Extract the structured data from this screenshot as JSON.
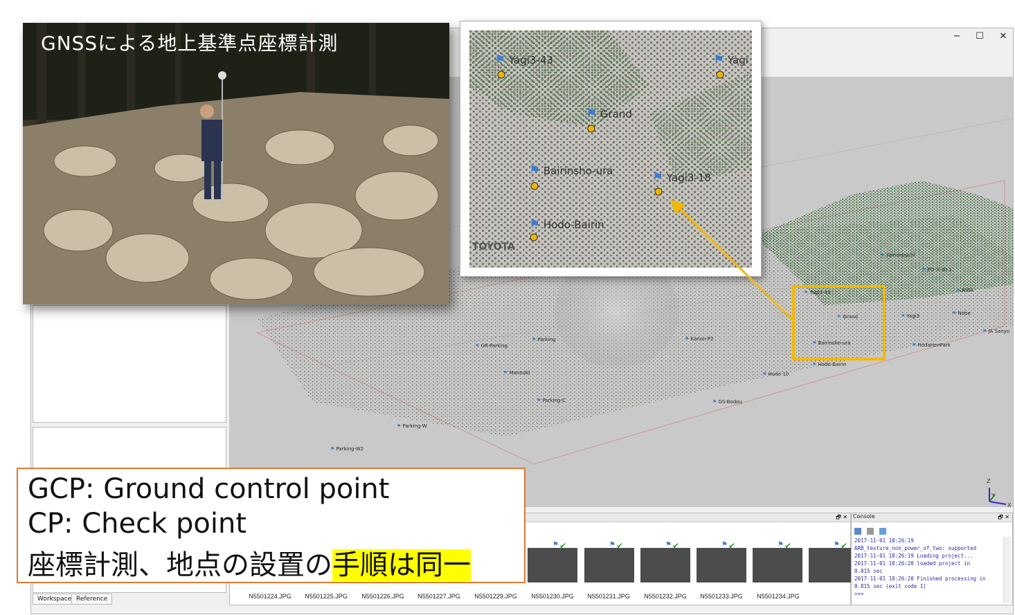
{
  "photo": {
    "title": "GNSSによる地上基準点座標計測"
  },
  "window_controls": {
    "minimize": "−",
    "maximize": "☐",
    "close": "✕"
  },
  "info_box": {
    "line1": "GCP: Ground control point",
    "line2": "CP: Check point",
    "line3_prefix": "座標計測、地点の設置の",
    "line3_highlight": "手順は同一"
  },
  "left_panel": {
    "tabs": [
      "Workspace",
      "Reference"
    ]
  },
  "zoom_markers": [
    {
      "label": "Yagi3-43"
    },
    {
      "label": "Yagi"
    },
    {
      "label": "Grand"
    },
    {
      "label": "Bairinsho-ura"
    },
    {
      "label": "Yagi3-18"
    },
    {
      "label": "Hodo-Bairin"
    }
  ],
  "zoom_text": "TOYOTA",
  "scene_markers": [
    {
      "label": "GR-Parking"
    },
    {
      "label": "Parking"
    },
    {
      "label": "Kanon-P2"
    },
    {
      "label": "Mannobi"
    },
    {
      "label": "Parking-C"
    },
    {
      "label": "Parking-W"
    },
    {
      "label": "Parking-W2"
    },
    {
      "label": "GS-Bodou"
    },
    {
      "label": "Hodo-10"
    },
    {
      "label": "Bairinsho-ura"
    },
    {
      "label": "Hodo-Bairin"
    },
    {
      "label": "Grand"
    },
    {
      "label": "Yagi3-43"
    },
    {
      "label": "PO-3-30-1"
    },
    {
      "label": "NWA"
    },
    {
      "label": "Yagi3"
    },
    {
      "label": "Nobe"
    },
    {
      "label": "HodaHenPark"
    },
    {
      "label": "JA Sanyo"
    },
    {
      "label": "Yamanouchi"
    }
  ],
  "axes": {
    "z": "Z",
    "y": "Y",
    "x": "X"
  },
  "photos": [
    "N5501224.JPG",
    "N5501225.JPG",
    "N5501226.JPG",
    "N5501227.JPG",
    "N5501229.JPG",
    "N5501230.JPG",
    "N5501231.JPG",
    "N5501232.JPG",
    "N5501233.JPG",
    "N5501234.JPG"
  ],
  "photo_panel_controls": "🗗 ✕",
  "console": {
    "title": "Console",
    "controls": "🗗 ✕",
    "lines": [
      "2017-11-01 18:26:19",
      "ARB_texture_non_power_of_two: supported",
      "2017-11-01 18:26:19 Loading project...",
      "2017-11-01 18:26:20 loaded project in",
      "0.815 sec",
      "2017-11-01 18:26:20 Finished processing in",
      "0.815 sec (exit code 1)",
      ">>>"
    ]
  }
}
